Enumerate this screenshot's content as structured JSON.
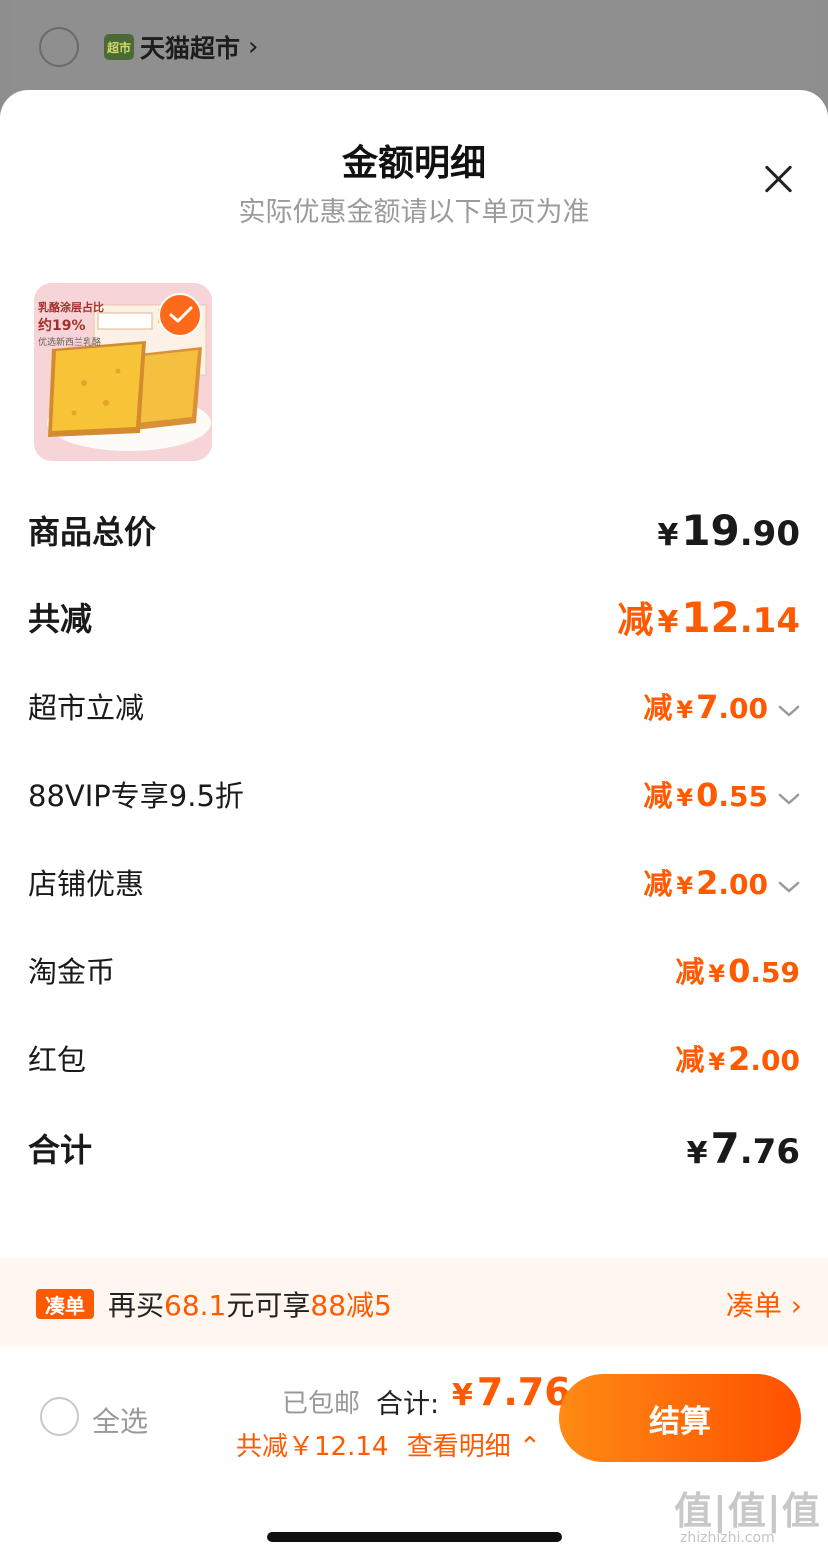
{
  "background": {
    "store_name": "天猫超市",
    "store_logo_text": "超市"
  },
  "sheet": {
    "title": "金额明细",
    "subtitle": "实际优惠金额请以下单页为准"
  },
  "product": {
    "thumbnail_caption_1": "乳酪涂层占比",
    "thumbnail_caption_2": "约19%",
    "thumbnail_caption_3": "优选新西兰乳酪",
    "selected": true
  },
  "details": {
    "subtotal": {
      "label": "商品总价",
      "symbol": "¥",
      "int": "19",
      "dec": ".90"
    },
    "total_discount": {
      "label": "共减",
      "prefix": "减",
      "symbol": "¥",
      "int": "12",
      "dec": ".14"
    },
    "items": [
      {
        "label": "超市立减",
        "prefix": "减",
        "symbol": "¥",
        "int": "7",
        "dec": ".00",
        "expandable": true
      },
      {
        "label": "88VIP专享9.5折",
        "prefix": "减",
        "symbol": "¥",
        "int": "0",
        "dec": ".55",
        "expandable": true
      },
      {
        "label": "店铺优惠",
        "prefix": "减",
        "symbol": "¥",
        "int": "2",
        "dec": ".00",
        "expandable": true
      },
      {
        "label": "淘金币",
        "prefix": "减",
        "symbol": "¥",
        "int": "0",
        "dec": ".59",
        "expandable": false
      },
      {
        "label": "红包",
        "prefix": "减",
        "symbol": "¥",
        "int": "2",
        "dec": ".00",
        "expandable": false
      }
    ],
    "grand_total": {
      "label": "合计",
      "symbol": "¥",
      "int": "7",
      "dec": ".76"
    }
  },
  "promo": {
    "tag": "凑单",
    "text_1": "再买",
    "amount": "68.1",
    "text_2": "元可享",
    "offer": "88减5",
    "link_label": "凑单"
  },
  "checkout": {
    "select_all_label": "全选",
    "shipping": "已包邮",
    "total_label": "合计:",
    "total_symbol": "¥",
    "total_value": "7.76",
    "savings_text": "共减￥12.14",
    "details_link": "查看明细",
    "button_label": "结算"
  },
  "watermark": {
    "text": "值|值|值",
    "url": "zhizhizhi.com"
  },
  "colors": {
    "accent": "#ff5a00",
    "text": "#1a1a1a",
    "muted": "#9b9b9b"
  }
}
